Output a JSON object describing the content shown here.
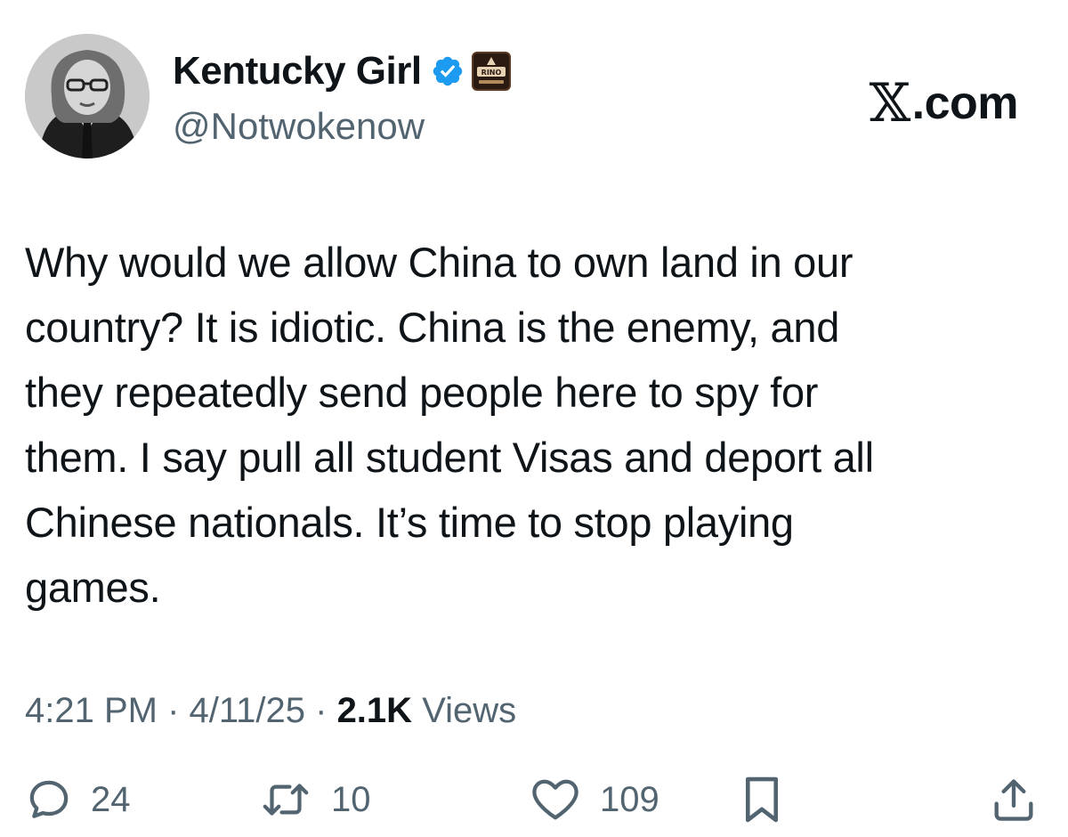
{
  "author": {
    "display_name": "Kentucky Girl",
    "handle": "@Notwokenow",
    "verified": true,
    "badge_label": "RINO"
  },
  "watermark": {
    "text": ".com"
  },
  "tweet": {
    "text": "Why would we allow China to own land in our\ncountry? It is idiotic. China is the enemy, and\nthey repeatedly send people here to spy for\nthem. I say pull all student Visas and deport all\nChinese nationals. It’s time to stop playing\ngames."
  },
  "meta": {
    "time": "4:21 PM",
    "date": "4/11/25",
    "separator": " · ",
    "views_count": "2.1K",
    "views_label": "Views"
  },
  "actions": {
    "replies": "24",
    "reposts": "10",
    "likes": "109"
  },
  "icons": {
    "verified": "verified-badge-icon",
    "reply": "speech-bubble-icon",
    "repost": "repost-arrows-icon",
    "like": "heart-icon",
    "bookmark": "bookmark-icon",
    "share": "share-upload-icon",
    "x_logo": "x-logo-icon"
  },
  "colors": {
    "text": "#0f1419",
    "secondary": "#536471",
    "verified": "#1d9bf0"
  }
}
